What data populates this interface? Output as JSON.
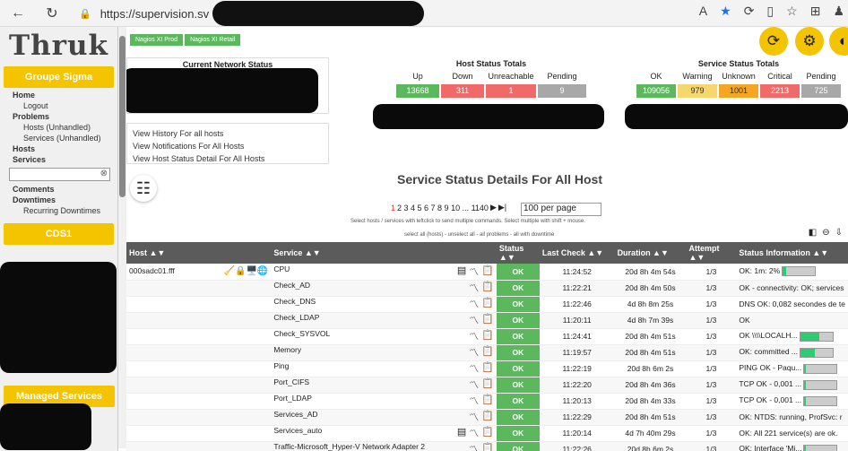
{
  "browser": {
    "url_prefix": "https://supervision.sv",
    "icons": [
      "back-icon",
      "reload-icon",
      "lock-icon",
      "read-aloud-icon",
      "favorite-star-icon",
      "extensions-icon",
      "split-icon",
      "favorites-icon",
      "collections-icon",
      "profile-icon"
    ]
  },
  "sidebar": {
    "logo": "Thruk",
    "group1": "Groupe Sigma",
    "links": [
      {
        "label": "Home",
        "sub": false
      },
      {
        "label": "Logout",
        "sub": true
      },
      {
        "label": "Problems",
        "sub": false
      },
      {
        "label": "Hosts (Unhandled)",
        "sub": true
      },
      {
        "label": "Services (Unhandled)",
        "sub": true
      },
      {
        "label": "Hosts",
        "sub": false
      },
      {
        "label": "Services",
        "sub": false
      }
    ],
    "links2": [
      {
        "label": "Comments",
        "sub": false
      },
      {
        "label": "Downtimes",
        "sub": false
      },
      {
        "label": "Recurring Downtimes",
        "sub": true
      }
    ],
    "group2": "CDS1",
    "group3": "Managed Services"
  },
  "backends": [
    "Nagios XI Prod",
    "Nagios XI Retail"
  ],
  "network_status": {
    "title": "Current Network Status"
  },
  "host_totals": {
    "title": "Host Status Totals",
    "cols": [
      {
        "label": "Up",
        "value": "13668",
        "color": "#5cb85c"
      },
      {
        "label": "Down",
        "value": "311",
        "color": "#f06a6a"
      },
      {
        "label": "Unreachable",
        "value": "1",
        "color": "#f06a6a"
      },
      {
        "label": "Pending",
        "value": "9",
        "color": "#a8a8a8"
      }
    ]
  },
  "service_totals": {
    "title": "Service Status Totals",
    "cols": [
      {
        "label": "OK",
        "value": "109056",
        "color": "#5cb85c"
      },
      {
        "label": "Warning",
        "value": "979",
        "color": "#f5d76e"
      },
      {
        "label": "Unknown",
        "value": "1001",
        "color": "#f5a623"
      },
      {
        "label": "Critical",
        "value": "2213",
        "color": "#f06a6a"
      },
      {
        "label": "Pending",
        "value": "725",
        "color": "#a8a8a8"
      }
    ]
  },
  "quick_links": [
    "View History For all hosts",
    "View Notifications For All Hosts",
    "View Host Status Detail For All Hosts"
  ],
  "page_title": "Service Status Details For All Host",
  "pager": {
    "current": "1",
    "pages": "2 3 4 5 6 7 8 9 10 ... 1140",
    "per_page": "100 per page"
  },
  "hint": "Select hosts / services with leftclick to send multiple commands. Select multiple with shift + mouse.",
  "hint2": "select all (hosts) - unselect all - all problems - all with downtime",
  "table": {
    "headers": [
      "Host ▲▼",
      "Service ▲▼",
      "Status ▲▼",
      "Last Check ▲▼",
      "Duration ▲▼",
      "Attempt ▲▼",
      "Status Information ▲▼"
    ],
    "host": "000sadc01.fff",
    "rows": [
      {
        "service": "CPU",
        "status": "OK",
        "last": "11:24:52",
        "dur": "20d 8h 4m 54s",
        "att": "1/3",
        "info": "OK: 1m: 2%",
        "bar": 0.1,
        "comment": true
      },
      {
        "service": "Check_AD",
        "status": "OK",
        "last": "11:22:21",
        "dur": "20d 8h 4m 50s",
        "att": "1/3",
        "info": "OK - connectivity: OK; services",
        "bar": null,
        "comment": false
      },
      {
        "service": "Check_DNS",
        "status": "OK",
        "last": "11:22:46",
        "dur": "4d 8h 8m 25s",
        "att": "1/3",
        "info": "DNS OK: 0,082 secondes de te",
        "bar": null,
        "comment": false
      },
      {
        "service": "Check_LDAP",
        "status": "OK",
        "last": "11:20:11",
        "dur": "4d 8h 7m 39s",
        "att": "1/3",
        "info": "OK",
        "bar": null,
        "comment": false
      },
      {
        "service": "Check_SYSVOL",
        "status": "OK",
        "last": "11:24:41",
        "dur": "20d 8h 4m 51s",
        "att": "1/3",
        "info": "OK \\\\\\\\LOCALH...",
        "bar": 0.6,
        "comment": false
      },
      {
        "service": "Memory",
        "status": "OK",
        "last": "11:19:57",
        "dur": "20d 8h 4m 51s",
        "att": "1/3",
        "info": "OK: committed ...",
        "bar": 0.45,
        "comment": false
      },
      {
        "service": "Ping",
        "status": "OK",
        "last": "11:22:19",
        "dur": "20d 8h 6m 2s",
        "att": "1/3",
        "info": "PING OK - Paqu...",
        "bar": 0.05,
        "comment": false
      },
      {
        "service": "Port_CIFS",
        "status": "OK",
        "last": "11:22:20",
        "dur": "20d 8h 4m 36s",
        "att": "1/3",
        "info": "TCP OK - 0,001 ...",
        "bar": 0.05,
        "comment": false
      },
      {
        "service": "Port_LDAP",
        "status": "OK",
        "last": "11:20:13",
        "dur": "20d 8h 4m 33s",
        "att": "1/3",
        "info": "TCP OK - 0,001 ...",
        "bar": 0.05,
        "comment": false
      },
      {
        "service": "Services_AD",
        "status": "OK",
        "last": "11:22:29",
        "dur": "20d 8h 4m 51s",
        "att": "1/3",
        "info": "OK: NTDS: running, ProfSvc: r",
        "bar": null,
        "comment": false
      },
      {
        "service": "Services_auto",
        "status": "OK",
        "last": "11:20:14",
        "dur": "4d 7h 40m 29s",
        "att": "1/3",
        "info": "OK: All 221 service(s) are ok.",
        "bar": null,
        "comment": true
      },
      {
        "service": "Traffic-Microsoft_Hyper-V Network Adapter 2",
        "status": "OK",
        "last": "11:22:26",
        "dur": "20d 8h 6m 2s",
        "att": "1/3",
        "info": "OK: Interface 'Mi...",
        "bar": 0.05,
        "comment": false
      }
    ]
  }
}
